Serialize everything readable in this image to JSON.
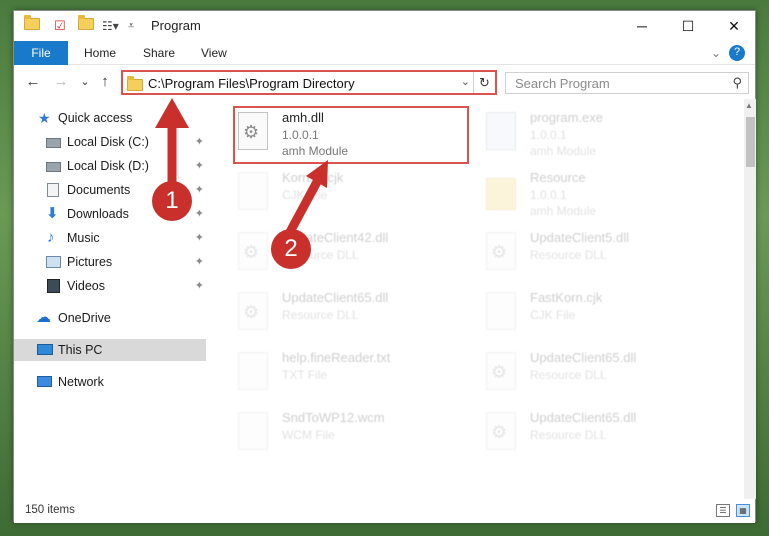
{
  "window": {
    "title": "Program",
    "controls": {
      "minimize": "─",
      "maximize": "☐",
      "close": "✕"
    }
  },
  "ribbon": {
    "tabs": [
      {
        "label": "File"
      },
      {
        "label": "Home"
      },
      {
        "label": "Share"
      },
      {
        "label": "View"
      }
    ],
    "expand_icon": "⌄",
    "help_icon": "?"
  },
  "nav": {
    "back": "←",
    "forward": "→",
    "recent": "⌄",
    "up": "↑",
    "address_path": "C:\\Program Files\\Program Directory",
    "address_dropdown": "⌄",
    "refresh": "↻",
    "search_placeholder": "Search Program",
    "search_icon": "⚲"
  },
  "sidebar": {
    "items": [
      {
        "label": "Quick access",
        "icon": "star-icon",
        "pinned": false
      },
      {
        "label": "Local Disk (C:)",
        "icon": "drive-icon",
        "pinned": true
      },
      {
        "label": "Local Disk (D:)",
        "icon": "drive-icon",
        "pinned": true
      },
      {
        "label": "Documents",
        "icon": "documents-icon",
        "pinned": true
      },
      {
        "label": "Downloads",
        "icon": "downloads-icon",
        "pinned": true
      },
      {
        "label": "Music",
        "icon": "music-icon",
        "pinned": true
      },
      {
        "label": "Pictures",
        "icon": "pictures-icon",
        "pinned": true
      },
      {
        "label": "Videos",
        "icon": "videos-icon",
        "pinned": true
      },
      {
        "label": "OneDrive",
        "icon": "onedrive-icon",
        "pinned": false
      },
      {
        "label": "This PC",
        "icon": "pc-icon",
        "pinned": false,
        "selected": true
      },
      {
        "label": "Network",
        "icon": "network-icon",
        "pinned": false
      }
    ],
    "pin_glyph": "📌"
  },
  "files": [
    {
      "name": "amh.dll",
      "line1": "1.0.0.1",
      "line2": "amh Module",
      "type": "dll",
      "highlighted": true
    },
    {
      "name": "program.exe",
      "line1": "1.0.0.1",
      "line2": "amh Module",
      "type": "exe"
    },
    {
      "name": "Korrect.cjk",
      "line1": "CJK File",
      "line2": "",
      "type": "file"
    },
    {
      "name": "Resource",
      "line1": "1.0.0.1",
      "line2": "amh Module",
      "type": "folder"
    },
    {
      "name": "UpdateClient42.dll",
      "line1": "Resource DLL",
      "line2": "",
      "type": "dll"
    },
    {
      "name": "UpdateClient5.dll",
      "line1": "Resource DLL",
      "line2": "",
      "type": "dll"
    },
    {
      "name": "UpdateClient65.dll",
      "line1": "Resource DLL",
      "line2": "",
      "type": "dll"
    },
    {
      "name": "FastKorn.cjk",
      "line1": "CJK File",
      "line2": "",
      "type": "file"
    },
    {
      "name": "help.fineReader.txt",
      "line1": "TXT File",
      "line2": "",
      "type": "file"
    },
    {
      "name": "UpdateClient65.dll",
      "line1": "Resource DLL",
      "line2": "",
      "type": "dll"
    },
    {
      "name": "SndToWP12.wcm",
      "line1": "WCM File",
      "line2": "",
      "type": "file"
    },
    {
      "name": "UpdateClient65.dll",
      "line1": "Resource DLL",
      "line2": "",
      "type": "dll"
    }
  ],
  "status": {
    "item_count": "150 items"
  },
  "annotations": {
    "badge1": "1",
    "badge2": "2",
    "color": "#c9302c"
  }
}
